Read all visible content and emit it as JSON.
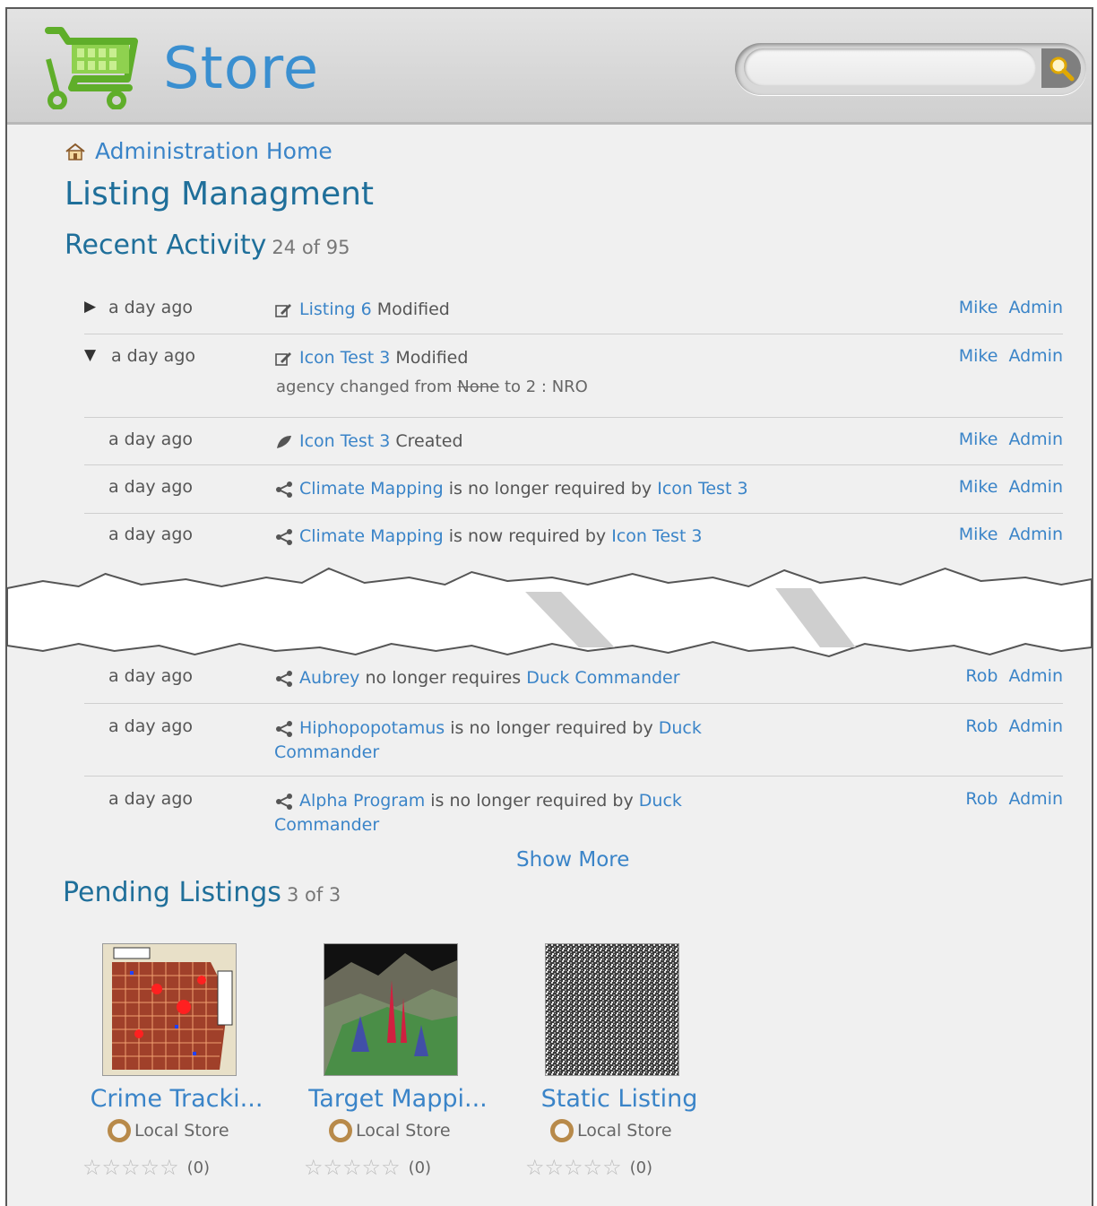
{
  "header": {
    "title": "Store",
    "search": {
      "placeholder": "",
      "value": ""
    }
  },
  "breadcrumb": {
    "label": "Administration Home"
  },
  "page_title": "Listing Managment",
  "recent": {
    "label": "Recent Activity",
    "count": "24 of 95",
    "items": [
      {
        "time": "a day ago",
        "link1": "Listing 6",
        "text1": "Modified",
        "link2": "",
        "text2": "",
        "user": "Mike",
        "role": "Admin",
        "caret": "▶"
      },
      {
        "time": "a day ago",
        "link1": "Icon Test 3",
        "text1": "Modified",
        "user": "Mike",
        "role": "Admin",
        "caret": "▼",
        "sub_prefix": "agency changed from",
        "sub_old": "None",
        "sub_mid": "to",
        "sub_new": "2 : NRO"
      },
      {
        "time": "a day ago",
        "link1": "Icon Test 3",
        "text1": "Created",
        "user": "Mike",
        "role": "Admin"
      },
      {
        "time": "a day ago",
        "link1": "Climate Mapping",
        "text1": "is no longer required by",
        "link2": "Icon Test 3",
        "user": "Mike",
        "role": "Admin"
      },
      {
        "time": "a day ago",
        "link1": "Climate Mapping",
        "text1": "is now required by",
        "link2": "Icon Test 3",
        "user": "Mike",
        "role": "Admin"
      },
      {
        "time": "a day ago",
        "link1": "Aubrey",
        "text1": "no longer requires",
        "link2": "Duck Commander",
        "user": "Rob",
        "role": "Admin"
      },
      {
        "time": "a day ago",
        "link1": "Hiphopopotamus",
        "text1": "is no longer required by",
        "link2": "Duck Commander",
        "user": "Rob",
        "role": "Admin"
      },
      {
        "time": "a day ago",
        "link1": "Alpha Program",
        "text1": "is no longer required by",
        "link2": "Duck Commander",
        "user": "Rob",
        "role": "Admin"
      }
    ],
    "show_more": "Show More"
  },
  "pending": {
    "label": "Pending Listings",
    "count": "3 of 3",
    "cards": [
      {
        "title": "Crime Tracki...",
        "store": "Local Store",
        "rating_count": "(0)",
        "rating": 0
      },
      {
        "title": "Target Mappi...",
        "store": "Local Store",
        "rating_count": "(0)",
        "rating": 0
      },
      {
        "title": "Static Listing",
        "store": "Local Store",
        "rating_count": "(0)",
        "rating": 0
      }
    ]
  },
  "colors": {
    "link": "#3a84c8",
    "heading": "#1f6f9a",
    "cart": "#6cb32f"
  }
}
